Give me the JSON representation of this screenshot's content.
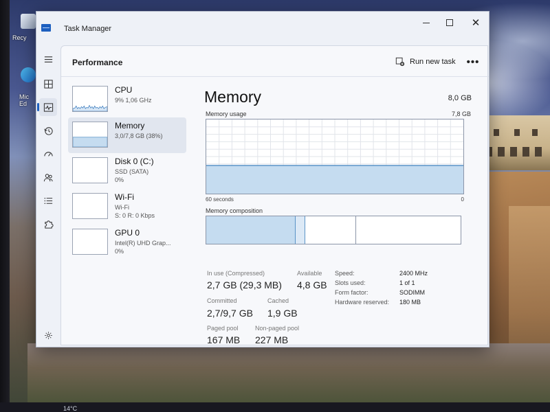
{
  "desktop": {
    "icons": [
      {
        "name": "recycle-bin",
        "label": "Recy"
      },
      {
        "name": "microsoft-edge",
        "label": "Mic\nEd"
      }
    ],
    "taskbar_weather": "14°C"
  },
  "window": {
    "title": "Task Manager",
    "controls": {
      "minimize": "minimize",
      "maximize": "maximize",
      "close": "close"
    }
  },
  "nav": {
    "items": [
      {
        "id": "menu",
        "icon": "hamburger-menu-icon"
      },
      {
        "id": "processes",
        "icon": "processes-grid-icon"
      },
      {
        "id": "performance",
        "icon": "performance-pulse-icon",
        "active": true
      },
      {
        "id": "app-history",
        "icon": "history-clock-icon"
      },
      {
        "id": "startup-apps",
        "icon": "startup-gauge-icon"
      },
      {
        "id": "users",
        "icon": "users-icon"
      },
      {
        "id": "details",
        "icon": "details-list-icon"
      },
      {
        "id": "services",
        "icon": "services-puzzle-icon"
      }
    ],
    "settings_icon": "settings-gear-icon"
  },
  "header": {
    "page_title": "Performance",
    "run_new_task": "Run new task",
    "more": "•••"
  },
  "resources": [
    {
      "name": "CPU",
      "line1": "9%  1,06 GHz",
      "line2": ""
    },
    {
      "name": "Memory",
      "line1": "3,0/7,8 GB (38%)",
      "line2": "",
      "selected": true
    },
    {
      "name": "Disk 0 (C:)",
      "line1": "SSD (SATA)",
      "line2": "0%"
    },
    {
      "name": "Wi-Fi",
      "line1": "Wi-Fi",
      "line2": "S: 0  R: 0 Kbps"
    },
    {
      "name": "GPU 0",
      "line1": "Intel(R) UHD Grap...",
      "line2": "0%"
    }
  ],
  "detail": {
    "title": "Memory",
    "total": "8,0 GB",
    "usage_label": "Memory usage",
    "usage_max": "7,8 GB",
    "usage_fraction": 0.38,
    "axis_left": "60 seconds",
    "axis_right": "0",
    "composition_label": "Memory composition",
    "composition_fractions": {
      "in_use": 0.35,
      "modified": 0.04,
      "standby": 0.2,
      "free": 0.41
    },
    "stats": {
      "in_use_label": "In use (Compressed)",
      "in_use_value": "2,7 GB (29,3 MB)",
      "available_label": "Available",
      "available_value": "4,8 GB",
      "committed_label": "Committed",
      "committed_value": "2,7/9,7 GB",
      "cached_label": "Cached",
      "cached_value": "1,9 GB",
      "paged_label": "Paged pool",
      "paged_value": "167 MB",
      "nonpaged_label": "Non-paged pool",
      "nonpaged_value": "227 MB"
    },
    "specs": [
      {
        "label": "Speed:",
        "value": "2400 MHz"
      },
      {
        "label": "Slots used:",
        "value": "1 of 1"
      },
      {
        "label": "Form factor:",
        "value": "SODIMM"
      },
      {
        "label": "Hardware reserved:",
        "value": "180 MB"
      }
    ]
  },
  "colors": {
    "accent": "#1d5fbf",
    "memory_fill": "#c5dcf0",
    "memory_line": "#5a94c7",
    "cpu_line": "#3f7fc0"
  }
}
